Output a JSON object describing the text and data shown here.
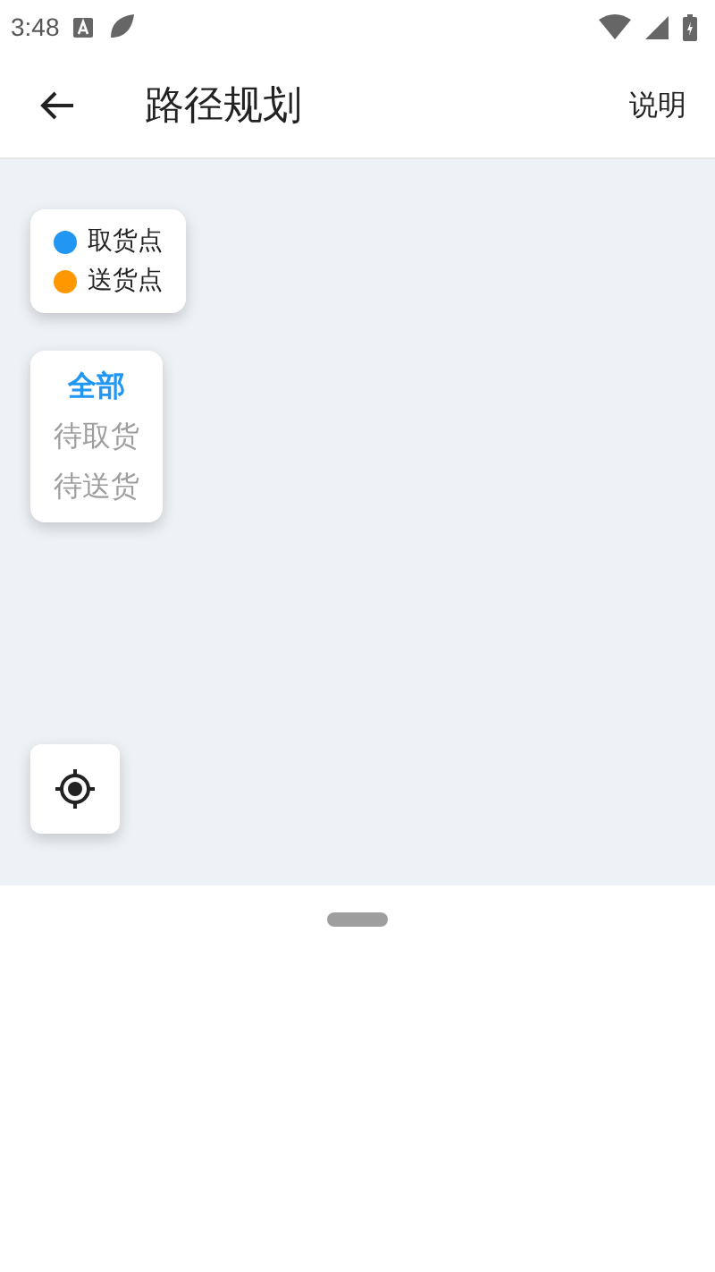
{
  "status_bar": {
    "time": "3:48"
  },
  "app_bar": {
    "title": "路径规划",
    "action": "说明"
  },
  "legend": [
    {
      "label": "取货点",
      "color": "#2196f3"
    },
    {
      "label": "送货点",
      "color": "#ff9800"
    }
  ],
  "filters": [
    {
      "label": "全部",
      "selected": true
    },
    {
      "label": "待取货",
      "selected": false
    },
    {
      "label": "待送货",
      "selected": false
    }
  ]
}
